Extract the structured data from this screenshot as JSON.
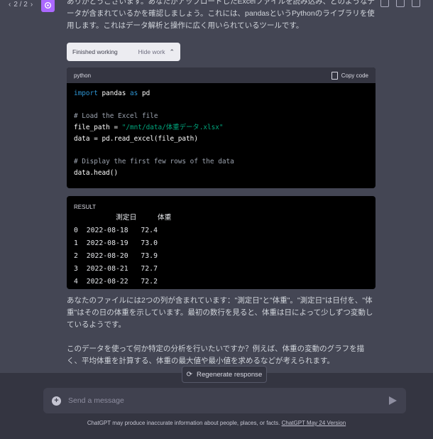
{
  "nav": {
    "prev": "‹",
    "page": "2 / 2",
    "next": "›"
  },
  "message_intro": "ありがとうございます。あなたがアップロードしたExcelファイルを読み込み、どのようなデータが含まれているかを確認しましょう。これには、pandasというPythonのライブラリを使用します。これはデータ解析と操作に広く用いられているツールです。",
  "working": {
    "status": "Finished working",
    "toggle": "Hide work"
  },
  "code_block": {
    "language": "python",
    "copy_label": "Copy code",
    "line1_kw1": "import",
    "line1_mod": " pandas ",
    "line1_kw2": "as",
    "line1_alias": " pd",
    "line3": "# Load the Excel file",
    "line4_pre": "file_path = ",
    "line4_str": "\"/mnt/data/体重データ.xlsx\"",
    "line5": "data = pd.read_excel(file_path)",
    "line7": "# Display the first few rows of the data",
    "line8": "data.head()"
  },
  "result": {
    "label": "RESULT",
    "header": "          測定日     体重",
    "rows": [
      "0  2022-08-18   72.4",
      "1  2022-08-19   73.0",
      "2  2022-08-20   73.9",
      "3  2022-08-21   72.7",
      "4  2022-08-22   72.2"
    ]
  },
  "para1": "あなたのファイルには2つの列が含まれています：\"測定日\"と\"体重\"。\"測定日\"は日付を、\"体重\"はその日の体重を示しています。最初の数行を見ると、体重は日によって少しずつ変動しているようです。",
  "para2": "このデータを使って何か特定の分析を行いたいですか？例えば、体重の変動のグラフを描く、平均体重を計算する、体重の最大値や最小値を求めるなどが考えられます。",
  "regenerate_label": "Regenerate response",
  "input_placeholder": "Send a message",
  "disclaimer_text": "ChatGPT may produce inaccurate information about people, places, or facts.",
  "disclaimer_link": "ChatGPT May 24 Version"
}
